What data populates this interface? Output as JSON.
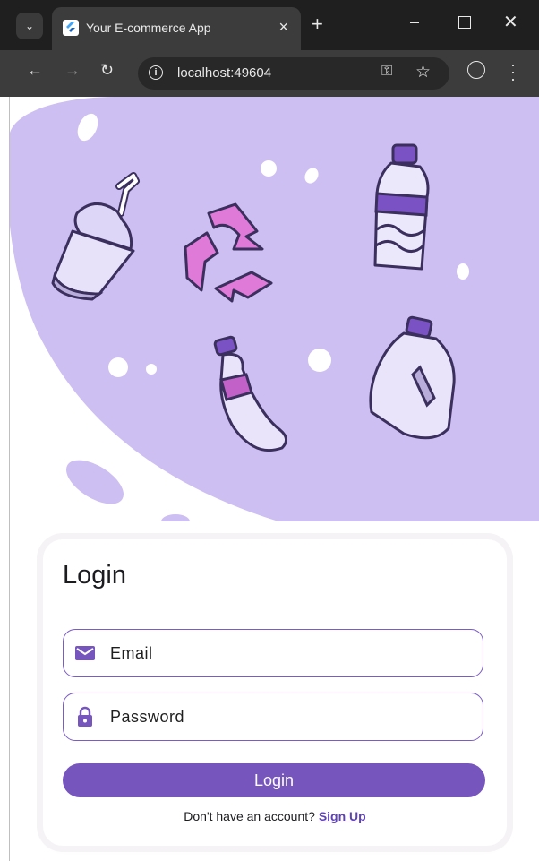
{
  "browser": {
    "tab_title": "Your E-commerce App",
    "tab_close": "×",
    "new_tab": "+",
    "url": "localhost:49604",
    "window_controls": {
      "minimize": "–",
      "close": "✕"
    }
  },
  "hero": {
    "illustration_icons": [
      "cup-icon",
      "recycle-icon",
      "water-bottle-icon",
      "soda-bottle-icon",
      "jug-icon"
    ]
  },
  "login": {
    "title": "Login",
    "email_placeholder": "Email",
    "password_placeholder": "Password",
    "button_label": "Login",
    "signup_prompt": "Don't have an account? ",
    "signup_link": "Sign Up"
  },
  "colors": {
    "accent": "#7656bd",
    "hero_blob": "#cdbff2",
    "field_border": "#7b5cc4"
  }
}
